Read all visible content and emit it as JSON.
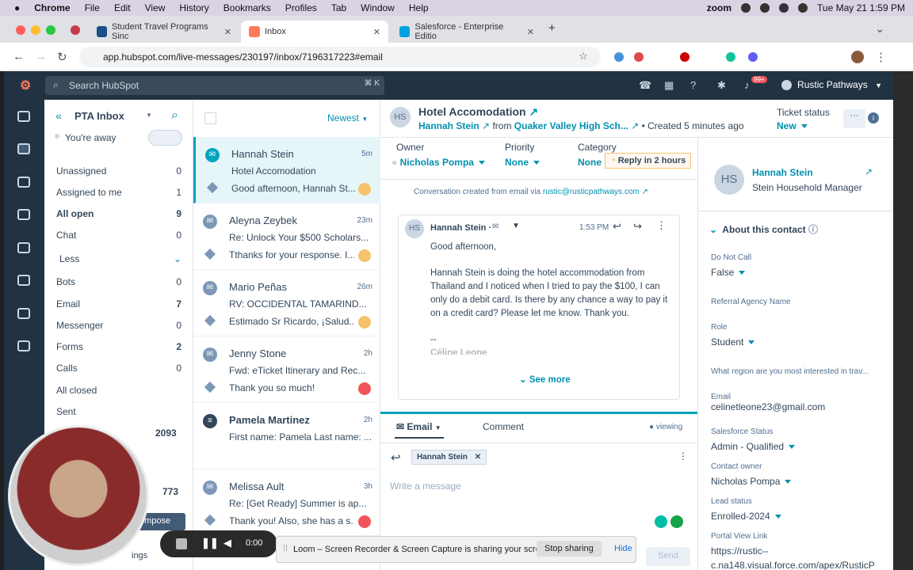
{
  "menubar": {
    "items": [
      "Chrome",
      "File",
      "Edit",
      "View",
      "History",
      "Bookmarks",
      "Profiles",
      "Tab",
      "Window",
      "Help"
    ],
    "datetime": "Tue May 21  1:59 PM",
    "zoom_label": "zoom"
  },
  "tabs": [
    {
      "title": "Student Travel Programs Sinc",
      "favicon_color": "#1a4f8a"
    },
    {
      "title": "Inbox",
      "favicon_color": "#ff7a59"
    },
    {
      "title": "Salesforce - Enterprise Editio",
      "favicon_color": "#00a1e0"
    }
  ],
  "url": "app.hubspot.com/live-messages/230197/inbox/7196317223#email",
  "header": {
    "search_placeholder": "Search HubSpot",
    "kbd": "⌘ K",
    "notifications": "99+",
    "account": "Rustic Pathways"
  },
  "inbox": {
    "title": "PTA Inbox",
    "status": "You're away",
    "sort": "Newest",
    "items": [
      {
        "label": "Unassigned",
        "count": "0"
      },
      {
        "label": "Assigned to me",
        "count": "1"
      },
      {
        "label": "All open",
        "count": "9"
      },
      {
        "label": "Chat",
        "count": "0"
      },
      {
        "label": "Less",
        "count": ""
      },
      {
        "label": "Bots",
        "count": "0"
      },
      {
        "label": "Email",
        "count": "7"
      },
      {
        "label": "Messenger",
        "count": "0"
      },
      {
        "label": "Forms",
        "count": "2"
      },
      {
        "label": "Calls",
        "count": "0"
      },
      {
        "label": "All closed",
        "count": ""
      },
      {
        "label": "Sent",
        "count": ""
      }
    ],
    "extra_count_1": "2093",
    "extra_count_2": "773",
    "compose_label": "ompose",
    "settings_label": "ings"
  },
  "conversations": [
    {
      "name": "Hannah Stein",
      "time": "5m",
      "subject": "Hotel Accomodation",
      "preview": "Good afternoon, Hannah St...",
      "badge": "#f5c26b"
    },
    {
      "name": "Aleyna Zeybek",
      "time": "23m",
      "subject": "Re: Unlock Your $500 Scholars...",
      "preview": "Tthanks for your response. I...",
      "badge": "#f5c26b"
    },
    {
      "name": "Mario Peñas",
      "time": "26m",
      "subject": "RV: OCCIDENTAL TAMARIND...",
      "preview": "Estimado Sr Ricardo, ¡Salud...",
      "badge": "#f5c26b"
    },
    {
      "name": "Jenny Stone",
      "time": "2h",
      "subject": "Fwd: eTicket Itinerary and Rec...",
      "preview": "Thank you so much!",
      "badge": "#f2545b"
    },
    {
      "name": "Pamela Martinez",
      "time": "2h",
      "subject": "First name: Pamela Last name: ...",
      "preview": "",
      "badge": ""
    },
    {
      "name": "Melissa Ault",
      "time": "3h",
      "subject": "Re: [Get Ready] Summer is ap...",
      "preview": "Thank you! Also, she has a s...",
      "badge": "#f2545b"
    }
  ],
  "ticket": {
    "avatar": "HS",
    "title": "Hotel Accomodation",
    "contact": "Hannah Stein",
    "from_text": "from",
    "company": "Quaker Valley High Sch...",
    "created": "• Created 5 minutes ago",
    "status_label": "Ticket status",
    "status_value": "New",
    "owner_label": "Owner",
    "owner_value": "Nicholas Pompa",
    "priority_label": "Priority",
    "priority_value": "None",
    "category_label": "Category",
    "category_value": "None",
    "sla": "Reply in 2 hours"
  },
  "message": {
    "created_via": "Conversation created from email via",
    "via_address": "rustic@rusticpathways.com",
    "sender": "Hannah Stein ·",
    "time": "1:53 PM",
    "greeting": "Good afternoon,",
    "body": "Hannah Stein is doing the hotel accommodation from Thailand and I noticed when I tried to pay the $100, I can only do a debit card. Is there by any chance a way to pay it on a credit card? Please let me know. Thank you.",
    "sig_dash": "--",
    "sig_name": "Céline Leone",
    "see_more": "See more"
  },
  "composer": {
    "tab_email": "Email",
    "tab_comment": "Comment",
    "viewing": "viewing",
    "recipient": "Hannah Stein",
    "placeholder": "Write a message",
    "send": "Send"
  },
  "contact": {
    "avatar": "HS",
    "name": "Hannah Stein",
    "title": "Stein Household Manager",
    "section": "About this contact",
    "props": [
      {
        "label": "Do Not Call",
        "value": "False"
      },
      {
        "label": "Referral Agency Name",
        "value": ""
      },
      {
        "label": "Role",
        "value": "Student"
      },
      {
        "label": "What region are you most interested in trav...",
        "value": ""
      },
      {
        "label": "Email",
        "value": "celinetleone23@gmail.com"
      },
      {
        "label": "Salesforce Status",
        "value": "Admin - Qualified"
      },
      {
        "label": "Contact owner",
        "value": "Nicholas Pompa"
      },
      {
        "label": "Lead status",
        "value": "Enrolled-2024"
      },
      {
        "label": "Portal View Link",
        "value": "https://rustic--"
      },
      {
        "label": "",
        "value": "c.na148.visual.force.com/apex/RusticP"
      }
    ]
  },
  "loom": {
    "timer": "0:00",
    "message": "Loom – Screen Recorder & Screen Capture is sharing your screen.",
    "stop": "Stop sharing",
    "hide": "Hide"
  }
}
